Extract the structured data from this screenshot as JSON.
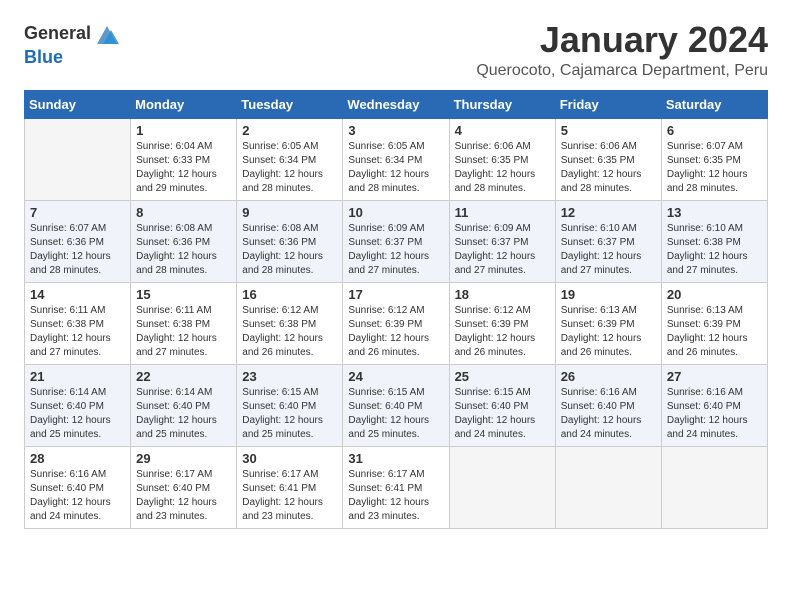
{
  "header": {
    "logo_general": "General",
    "logo_blue": "Blue",
    "title": "January 2024",
    "subtitle": "Querocoto, Cajamarca Department, Peru"
  },
  "weekdays": [
    "Sunday",
    "Monday",
    "Tuesday",
    "Wednesday",
    "Thursday",
    "Friday",
    "Saturday"
  ],
  "weeks": [
    [
      {
        "day": "",
        "info": ""
      },
      {
        "day": "1",
        "info": "Sunrise: 6:04 AM\nSunset: 6:33 PM\nDaylight: 12 hours\nand 29 minutes."
      },
      {
        "day": "2",
        "info": "Sunrise: 6:05 AM\nSunset: 6:34 PM\nDaylight: 12 hours\nand 28 minutes."
      },
      {
        "day": "3",
        "info": "Sunrise: 6:05 AM\nSunset: 6:34 PM\nDaylight: 12 hours\nand 28 minutes."
      },
      {
        "day": "4",
        "info": "Sunrise: 6:06 AM\nSunset: 6:35 PM\nDaylight: 12 hours\nand 28 minutes."
      },
      {
        "day": "5",
        "info": "Sunrise: 6:06 AM\nSunset: 6:35 PM\nDaylight: 12 hours\nand 28 minutes."
      },
      {
        "day": "6",
        "info": "Sunrise: 6:07 AM\nSunset: 6:35 PM\nDaylight: 12 hours\nand 28 minutes."
      }
    ],
    [
      {
        "day": "7",
        "info": "Sunrise: 6:07 AM\nSunset: 6:36 PM\nDaylight: 12 hours\nand 28 minutes."
      },
      {
        "day": "8",
        "info": "Sunrise: 6:08 AM\nSunset: 6:36 PM\nDaylight: 12 hours\nand 28 minutes."
      },
      {
        "day": "9",
        "info": "Sunrise: 6:08 AM\nSunset: 6:36 PM\nDaylight: 12 hours\nand 28 minutes."
      },
      {
        "day": "10",
        "info": "Sunrise: 6:09 AM\nSunset: 6:37 PM\nDaylight: 12 hours\nand 27 minutes."
      },
      {
        "day": "11",
        "info": "Sunrise: 6:09 AM\nSunset: 6:37 PM\nDaylight: 12 hours\nand 27 minutes."
      },
      {
        "day": "12",
        "info": "Sunrise: 6:10 AM\nSunset: 6:37 PM\nDaylight: 12 hours\nand 27 minutes."
      },
      {
        "day": "13",
        "info": "Sunrise: 6:10 AM\nSunset: 6:38 PM\nDaylight: 12 hours\nand 27 minutes."
      }
    ],
    [
      {
        "day": "14",
        "info": "Sunrise: 6:11 AM\nSunset: 6:38 PM\nDaylight: 12 hours\nand 27 minutes."
      },
      {
        "day": "15",
        "info": "Sunrise: 6:11 AM\nSunset: 6:38 PM\nDaylight: 12 hours\nand 27 minutes."
      },
      {
        "day": "16",
        "info": "Sunrise: 6:12 AM\nSunset: 6:38 PM\nDaylight: 12 hours\nand 26 minutes."
      },
      {
        "day": "17",
        "info": "Sunrise: 6:12 AM\nSunset: 6:39 PM\nDaylight: 12 hours\nand 26 minutes."
      },
      {
        "day": "18",
        "info": "Sunrise: 6:12 AM\nSunset: 6:39 PM\nDaylight: 12 hours\nand 26 minutes."
      },
      {
        "day": "19",
        "info": "Sunrise: 6:13 AM\nSunset: 6:39 PM\nDaylight: 12 hours\nand 26 minutes."
      },
      {
        "day": "20",
        "info": "Sunrise: 6:13 AM\nSunset: 6:39 PM\nDaylight: 12 hours\nand 26 minutes."
      }
    ],
    [
      {
        "day": "21",
        "info": "Sunrise: 6:14 AM\nSunset: 6:40 PM\nDaylight: 12 hours\nand 25 minutes."
      },
      {
        "day": "22",
        "info": "Sunrise: 6:14 AM\nSunset: 6:40 PM\nDaylight: 12 hours\nand 25 minutes."
      },
      {
        "day": "23",
        "info": "Sunrise: 6:15 AM\nSunset: 6:40 PM\nDaylight: 12 hours\nand 25 minutes."
      },
      {
        "day": "24",
        "info": "Sunrise: 6:15 AM\nSunset: 6:40 PM\nDaylight: 12 hours\nand 25 minutes."
      },
      {
        "day": "25",
        "info": "Sunrise: 6:15 AM\nSunset: 6:40 PM\nDaylight: 12 hours\nand 24 minutes."
      },
      {
        "day": "26",
        "info": "Sunrise: 6:16 AM\nSunset: 6:40 PM\nDaylight: 12 hours\nand 24 minutes."
      },
      {
        "day": "27",
        "info": "Sunrise: 6:16 AM\nSunset: 6:40 PM\nDaylight: 12 hours\nand 24 minutes."
      }
    ],
    [
      {
        "day": "28",
        "info": "Sunrise: 6:16 AM\nSunset: 6:40 PM\nDaylight: 12 hours\nand 24 minutes."
      },
      {
        "day": "29",
        "info": "Sunrise: 6:17 AM\nSunset: 6:40 PM\nDaylight: 12 hours\nand 23 minutes."
      },
      {
        "day": "30",
        "info": "Sunrise: 6:17 AM\nSunset: 6:41 PM\nDaylight: 12 hours\nand 23 minutes."
      },
      {
        "day": "31",
        "info": "Sunrise: 6:17 AM\nSunset: 6:41 PM\nDaylight: 12 hours\nand 23 minutes."
      },
      {
        "day": "",
        "info": ""
      },
      {
        "day": "",
        "info": ""
      },
      {
        "day": "",
        "info": ""
      }
    ]
  ]
}
